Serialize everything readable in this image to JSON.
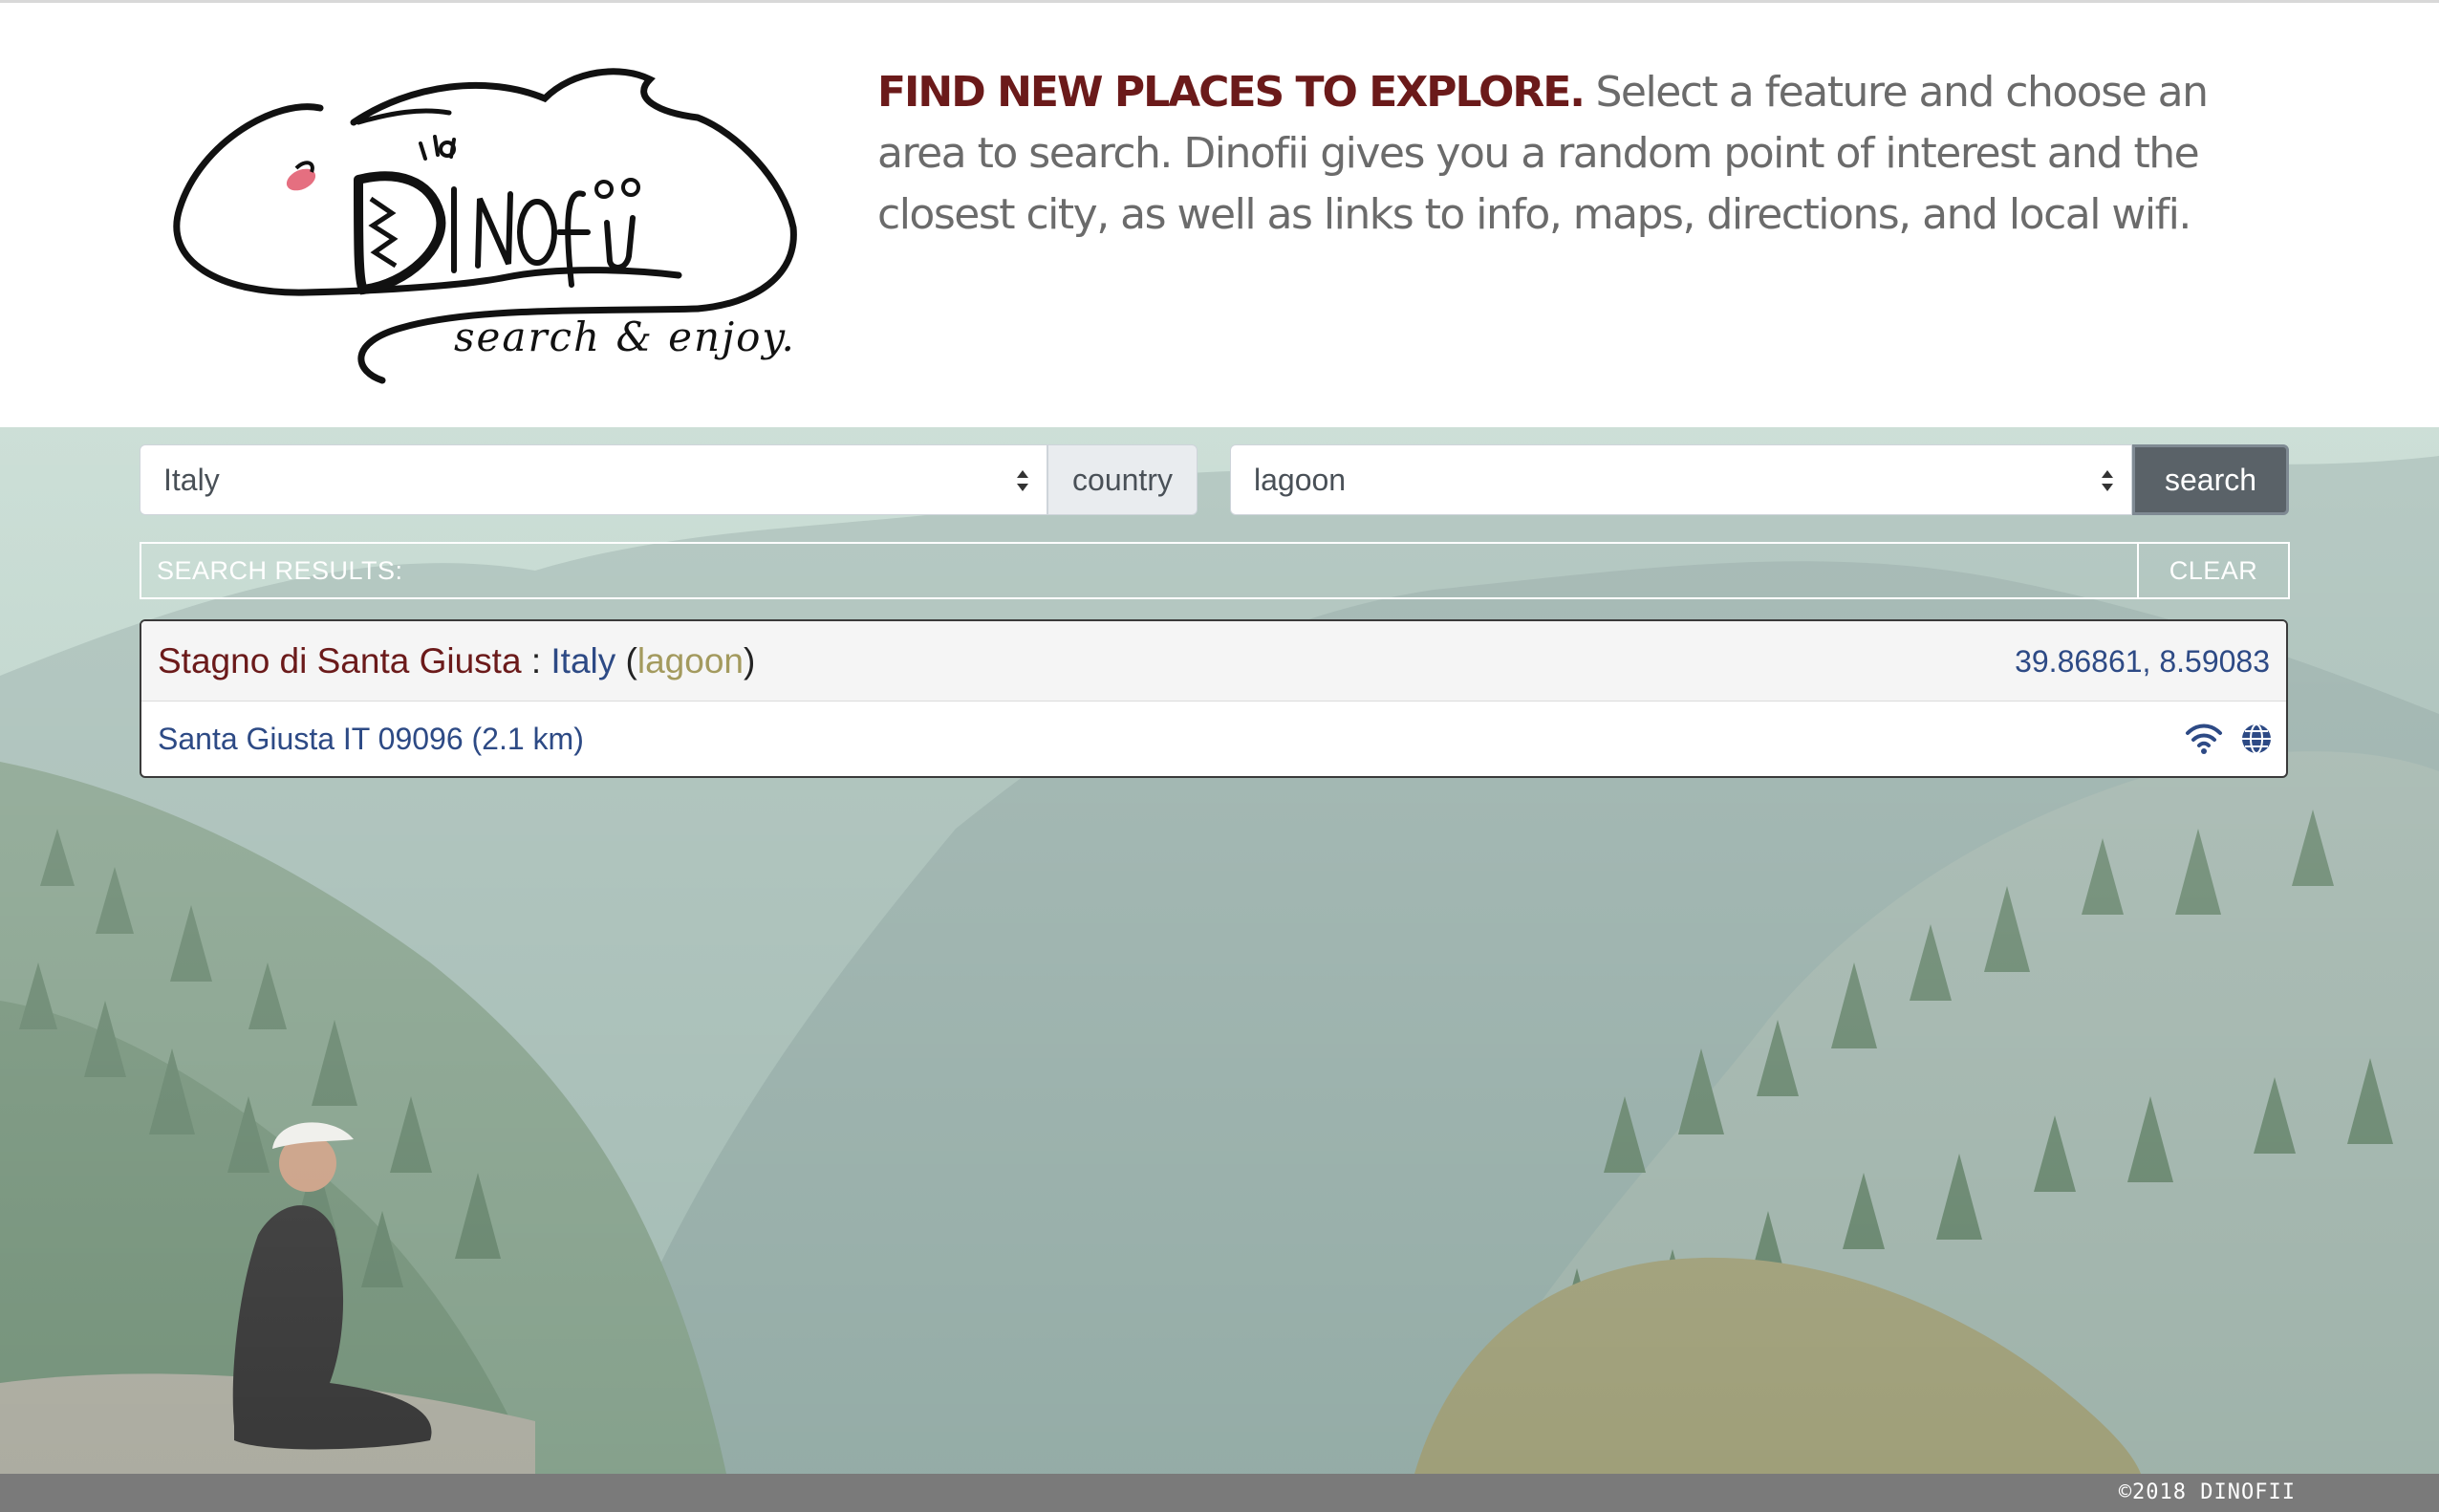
{
  "brand": {
    "logo_text": "Dinofii",
    "tagline": "search & enjoy."
  },
  "intro": {
    "heading": "FIND NEW PLACES TO EXPLORE.",
    "text": " Select a feature and choose an area to search. Dinofii gives you a random point of interest and the closest city, as well as links to info, maps, directions, and local wifi."
  },
  "search": {
    "area_value": "Italy",
    "area_type_label": "country",
    "feature_value": "lagoon",
    "button_label": "search"
  },
  "results": {
    "label": "SEARCH RESULTS:",
    "clear_label": "CLEAR",
    "items": [
      {
        "name": "Stagno di Santa Giusta",
        "separator": " : ",
        "country": "Italy",
        "open_paren": " (",
        "feature": "lagoon",
        "close_paren": ")",
        "coords": "39.86861, 8.59083",
        "city": "Santa Giusta IT 09096 (2.1 km)"
      }
    ]
  },
  "footer": {
    "copyright": "©2018 DINOFII"
  },
  "colors": {
    "heading": "#6b1a1a",
    "link": "#2d4a85",
    "feature": "#a39a5e",
    "button": "#5a6268",
    "footer": "#7a7a7a"
  },
  "icons": [
    "logo-icon",
    "select-arrows-icon",
    "wifi-icon",
    "globe-icon"
  ]
}
